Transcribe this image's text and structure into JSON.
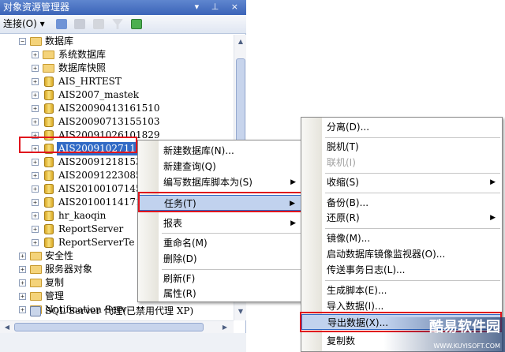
{
  "panel": {
    "title": "对象资源管理器",
    "title_controls": "▾ ⊥ ×",
    "connect_label": "连接(O)",
    "connect_arrow": "▾"
  },
  "tree": {
    "databases": "数据库",
    "system_databases": "系统数据库",
    "snapshots": "数据库快照",
    "db_items": [
      "AIS_HRTEST",
      "AIS2007_mastek",
      "AIS20090413161510",
      "AIS20090713155103",
      "AIS20091026101829",
      "AIS2009102711",
      "AIS20091218153",
      "AIS20091223085",
      "AIS20100107145",
      "AIS20100114171",
      "hr_kaoqin",
      "ReportServer",
      "ReportServerTe"
    ],
    "security": "安全性",
    "server_objects": "服务器对象",
    "replication": "复制",
    "management": "管理",
    "notification": "Notification Serv",
    "agent": "SQL Server 代理(已禁用代理 XP)"
  },
  "menu1": {
    "items": [
      "新建数据库(N)...",
      "新建查询(Q)",
      "编写数据库脚本为(S)",
      "任务(T)",
      "报表",
      "重命名(M)",
      "删除(D)",
      "刷新(F)",
      "属性(R)"
    ],
    "arrow": "▶"
  },
  "menu2": {
    "items": [
      "分离(D)...",
      "脱机(T)",
      "联机(I)",
      "收缩(S)",
      "备份(B)...",
      "还原(R)",
      "镜像(M)...",
      "启动数据库镜像监视器(O)...",
      "传送事务日志(L)...",
      "生成脚本(E)...",
      "导入数据(I)...",
      "导出数据(X)...",
      "复制数"
    ],
    "arrow": "▶"
  },
  "watermark": {
    "text": "酷易软件园",
    "url": "WWW.KUYISOFT.COM"
  },
  "colors": {
    "highlight_box": "#e0141d",
    "selection": "#316ac5"
  }
}
